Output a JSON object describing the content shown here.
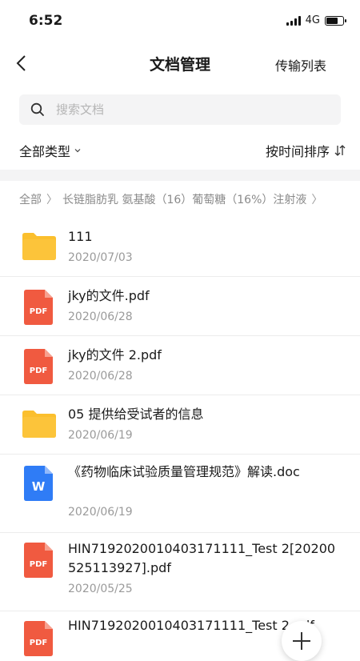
{
  "status": {
    "time": "6:52",
    "network": "4G"
  },
  "nav": {
    "title": "文档管理",
    "action": "传输列表"
  },
  "search": {
    "placeholder": "搜索文档"
  },
  "filter": {
    "type": "全部类型",
    "sort": "按时间排序"
  },
  "breadcrumb": {
    "root": "全部",
    "folder": "长链脂肪乳 氨基酸（16）葡萄糖（16%）注射液"
  },
  "files": [
    {
      "name": "111",
      "date": "2020/07/03",
      "icon": "folder-icon"
    },
    {
      "name": "jky的文件.pdf",
      "date": "2020/06/28",
      "icon": "pdf-icon",
      "badge": "PDF"
    },
    {
      "name": "jky的文件 2.pdf",
      "date": "2020/06/28",
      "icon": "pdf-icon",
      "badge": "PDF"
    },
    {
      "name": "05 提供给受试者的信息",
      "date": "2020/06/19",
      "icon": "folder-icon"
    },
    {
      "name": "《药物临床试验质量管理规范》解读.doc",
      "date": "2020/06/19",
      "icon": "word-icon",
      "badge": "W"
    },
    {
      "name": "HIN7192020010403171111_Test 2[20200525113927].pdf",
      "date": "2020/05/25",
      "icon": "pdf-icon",
      "badge": "PDF"
    },
    {
      "name": "HIN7192020010403171111_Test 2.pdf",
      "date": "",
      "icon": "pdf-icon",
      "badge": "PDF"
    }
  ],
  "colors": {
    "folder": "#fbbf2d",
    "pdf": "#f05a40",
    "word": "#2f7cf6"
  }
}
